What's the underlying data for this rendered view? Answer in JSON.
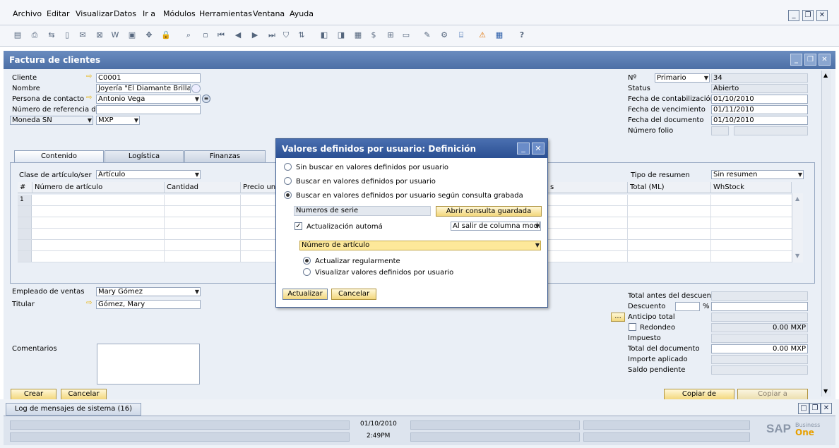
{
  "menu": [
    "Archivo",
    "Editar",
    "Visualizar",
    "Datos",
    "Ir a",
    "Módulos",
    "Herramientas",
    "Ventana",
    "Ayuda"
  ],
  "window": {
    "title": "Factura de clientes"
  },
  "header_left": {
    "cliente_label": "Cliente",
    "cliente_value": "C0001",
    "nombre_label": "Nombre",
    "nombre_value": "Joyería \"El Diamante Brillante\"",
    "contacto_label": "Persona de contacto",
    "contacto_value": "Antonio Vega",
    "referencia_label": "Número de referencia d",
    "referencia_value": "",
    "moneda_label": "Moneda SN",
    "moneda_value": "MXP"
  },
  "header_right": {
    "numero_label": "Nº",
    "serie_value": "Primario",
    "numero_value": "34",
    "status_label": "Status",
    "status_value": "Abierto",
    "fecha_cont_label": "Fecha de contabilización",
    "fecha_cont_value": "01/10/2010",
    "fecha_venc_label": "Fecha de vencimiento",
    "fecha_venc_value": "01/11/2010",
    "fecha_doc_label": "Fecha del documento",
    "fecha_doc_value": "01/10/2010",
    "folio_label": "Número folio"
  },
  "tabs": [
    "Contenido",
    "Logística",
    "Finanzas"
  ],
  "contenido": {
    "clase_label": "Clase de artículo/ser",
    "clase_value": "Artículo",
    "tipo_resumen_label": "Tipo de resumen",
    "tipo_resumen_value": "Sin resumen",
    "columns": [
      "#",
      "Número de artículo",
      "Cantidad",
      "Precio uni",
      "s",
      "Total (ML)",
      "WhStock"
    ],
    "first_row_number": "1"
  },
  "footer_left": {
    "empleado_label": "Empleado de ventas",
    "empleado_value": "Mary Gómez",
    "titular_label": "Titular",
    "titular_value": "Gómez, Mary",
    "comentarios_label": "Comentarios"
  },
  "footer_right": {
    "total_antes_label": "Total antes del descuento",
    "descuento_label": "Descuento",
    "percent_sign": "%",
    "anticipo_label": "Anticipo total",
    "anticipo_button": "...",
    "redondeo_label": "Redondeo",
    "redondeo_value": "0.00 MXP",
    "impuesto_label": "Impuesto",
    "total_doc_label": "Total del documento",
    "total_doc_value": "0.00 MXP",
    "importe_label": "Importe aplicado",
    "saldo_label": "Saldo pendiente"
  },
  "buttons": {
    "crear": "Crear",
    "cancelar": "Cancelar",
    "copiar_de": "Copiar de",
    "copiar_a": "Copiar a"
  },
  "dialog": {
    "title": "Valores definidos por usuario: Definición",
    "option1": "Sin buscar en valores definidos por usuario",
    "option2": "Buscar en valores definidos por usuario",
    "option3": "Buscar en valores definidos por usuario según consulta grabada",
    "query_value": "Numeros de serie",
    "open_query_button": "Abrir consulta guardada",
    "auto_update_label": "Actualización automá",
    "auto_update_trigger": "Al salir de columna modif.",
    "column_value": "Número de artículo",
    "sub_option1": "Actualizar regularmente",
    "sub_option2": "Visualizar valores definidos por usuario",
    "actualizar_button": "Actualizar",
    "cancelar_button": "Cancelar"
  },
  "status": {
    "msglog_tab": "Log de mensajes de sistema (16)",
    "date": "01/10/2010",
    "time": "2:49PM",
    "brand_sap": "SAP",
    "brand_business": "Business",
    "brand_one": "One"
  }
}
